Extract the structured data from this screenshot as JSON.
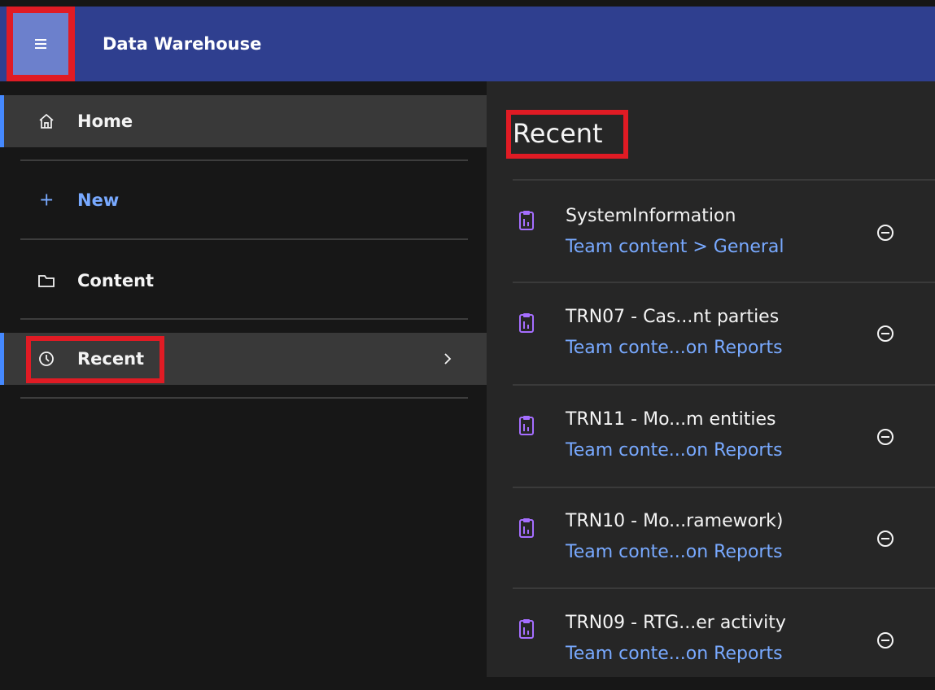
{
  "header": {
    "title": "Data Warehouse",
    "menu_icon": "hamburger-menu-icon",
    "background": "#2f3f8f"
  },
  "sidebar": {
    "items": [
      {
        "label": "Home",
        "icon": "home-icon",
        "active": true
      },
      {
        "label": "New",
        "icon": "plus-icon",
        "active": false
      },
      {
        "label": "Content",
        "icon": "folder-icon",
        "active": false
      },
      {
        "label": "Recent",
        "icon": "clock-icon",
        "active": true
      }
    ],
    "recent_chevron_icon": "chevron-right-icon"
  },
  "main": {
    "title": "Recent",
    "items": [
      {
        "name": "SystemInformation",
        "path": "Team content > General",
        "icon": "report-icon",
        "action_icon": "remove-icon"
      },
      {
        "name": "TRN07 - Cas...nt parties",
        "path": "Team conte...on Reports",
        "icon": "report-icon",
        "action_icon": "remove-icon"
      },
      {
        "name": "TRN11 - Mo...m entities",
        "path": "Team conte...on Reports",
        "icon": "report-icon",
        "action_icon": "remove-icon"
      },
      {
        "name": "TRN10 - Mo...ramework)",
        "path": "Team conte...on Reports",
        "icon": "report-icon",
        "action_icon": "remove-icon"
      },
      {
        "name": "TRN09 - RTG...er activity",
        "path": "Team conte...on Reports",
        "icon": "report-icon",
        "action_icon": "remove-icon"
      }
    ]
  },
  "colors": {
    "accent": "#4589ff",
    "link": "#78a9ff",
    "highlight": "#e01b24",
    "report_icon": "#a56eff"
  }
}
